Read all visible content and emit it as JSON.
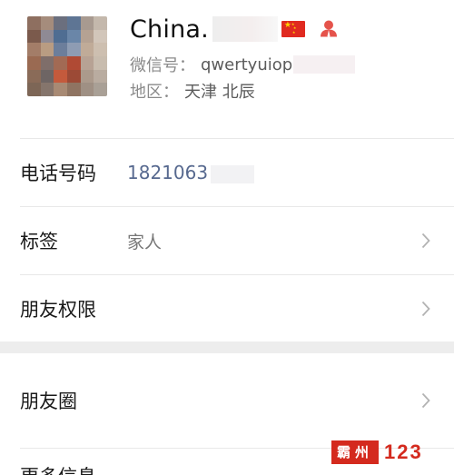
{
  "profile": {
    "display_name": "China.",
    "wechat_id_label": "微信号：",
    "wechat_id_value": "qwertyuiop",
    "region_label": "地区：",
    "region_value": "天津 北辰",
    "flag_icon": "china-flag-icon",
    "contact_icon": "person-icon",
    "accent_color": "#e5534b"
  },
  "rows": {
    "phone": {
      "label": "电话号码",
      "value": "1821063"
    },
    "tags": {
      "label": "标签",
      "value": "家人"
    },
    "permissions": {
      "label": "朋友权限"
    },
    "moments": {
      "label": "朋友圈"
    },
    "more": {
      "label": "更多信息"
    }
  },
  "watermark": {
    "badge_text": "霸州",
    "number_text": "123",
    "color": "#d42a1e"
  }
}
